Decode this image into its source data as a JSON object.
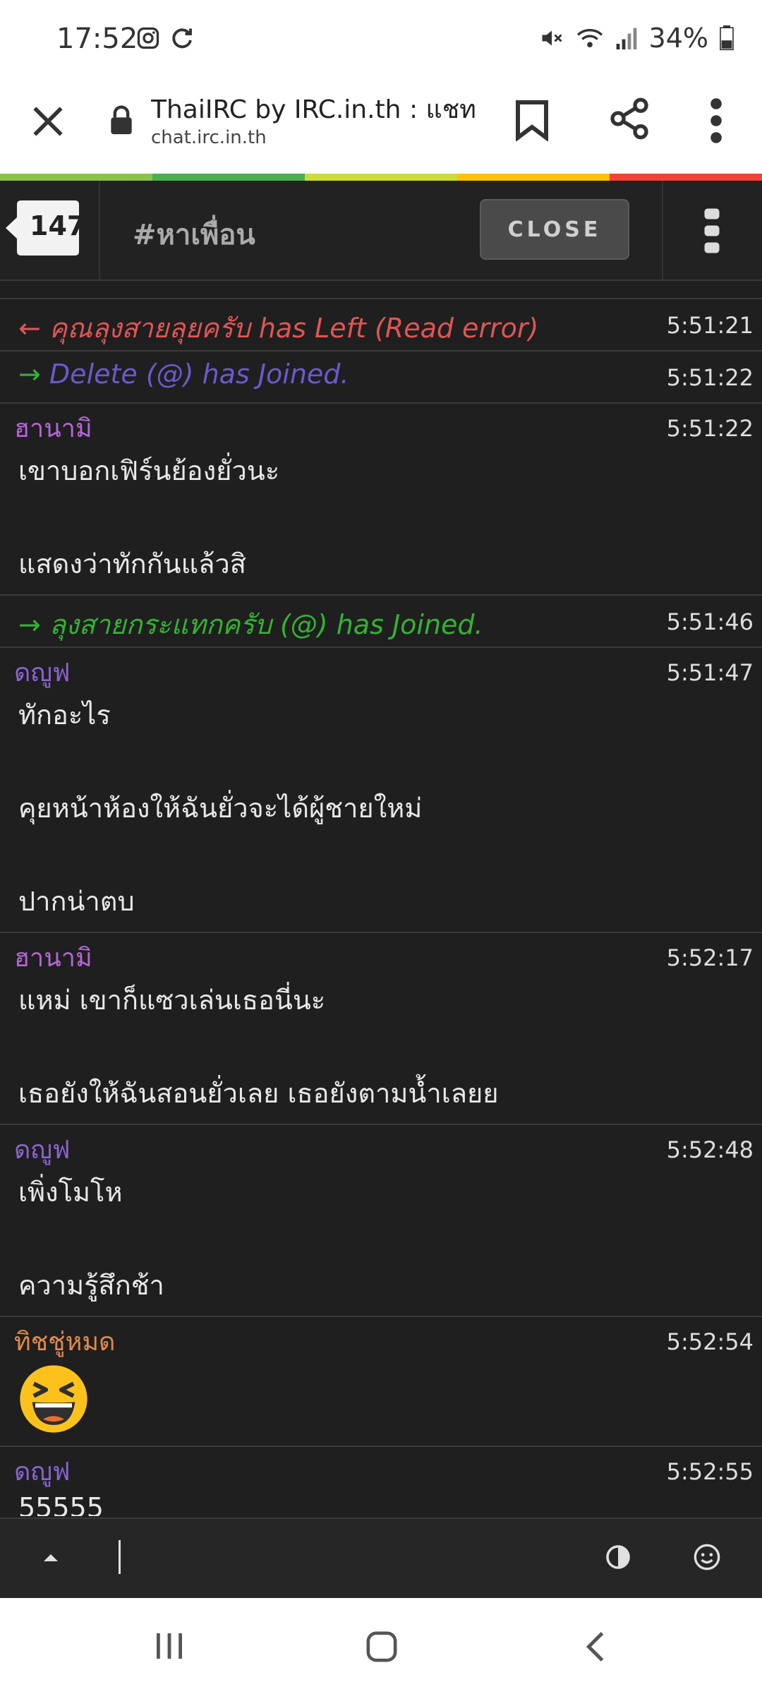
{
  "status_bar": {
    "time": "17:52",
    "battery": "34%"
  },
  "browser": {
    "page_title": "ThaiIRC by IRC.in.th : แชท ...",
    "url": "chat.irc.in.th"
  },
  "rainbow_colors": [
    "#8bc34a",
    "#4caf50",
    "#cddc39",
    "#ffc107",
    "#f44336"
  ],
  "channel": {
    "user_count": "147",
    "name": "#หาเพื่อน",
    "close_label": "CLOSE"
  },
  "messages": [
    {
      "type": "part",
      "text": "← คุณลุงสายลุยครับ has Left (Read error)",
      "time": "5:51:21",
      "color": "#e05555"
    },
    {
      "type": "join",
      "text": "→ Delete (@) has Joined.",
      "time": "5:51:22",
      "color": "#6a5acd",
      "arrow_color": "#34b233"
    },
    {
      "type": "message",
      "nick": "ฮานามิ",
      "nick_color": "#b565d8",
      "time": "5:51:22",
      "lines": [
        "เขาบอกเฟิร์นย้องยั่วนะ",
        "",
        "แสดงว่าทักกันแล้วสิ"
      ]
    },
    {
      "type": "join",
      "text": "→ ลุงสายกระแทกครับ (@) has Joined.",
      "time": "5:51:46",
      "color": "#34b233"
    },
    {
      "type": "message",
      "nick": "ดญูฟ",
      "nick_color": "#8a63d2",
      "time": "5:51:47",
      "lines": [
        "ทักอะไร",
        "",
        "คุยหน้าห้องให้ฉันยั่วจะได้ผู้ชายใหม่",
        "",
        "ปากน่าตบ"
      ]
    },
    {
      "type": "message",
      "nick": "ฮานามิ",
      "nick_color": "#b565d8",
      "time": "5:52:17",
      "lines": [
        "แหม่ เขาก็แซวเล่นเธอนี่นะ",
        "",
        "เธอยังให้ฉันสอนยั่วเลย เธอยังตามน้ำเลยย"
      ]
    },
    {
      "type": "message",
      "nick": "ดญูฟ",
      "nick_color": "#8a63d2",
      "time": "5:52:48",
      "lines": [
        "เพิ่งโมโห",
        "",
        "ความรู้สึกช้า"
      ]
    },
    {
      "type": "emoji",
      "nick": "ทิชชู่หมด",
      "nick_color": "#e0894b",
      "time": "5:52:54",
      "emoji": "laughing-face-icon"
    },
    {
      "type": "message",
      "nick": "ดญูฟ",
      "nick_color": "#8a63d2",
      "time": "5:52:55",
      "lines": [
        "55555"
      ]
    }
  ]
}
